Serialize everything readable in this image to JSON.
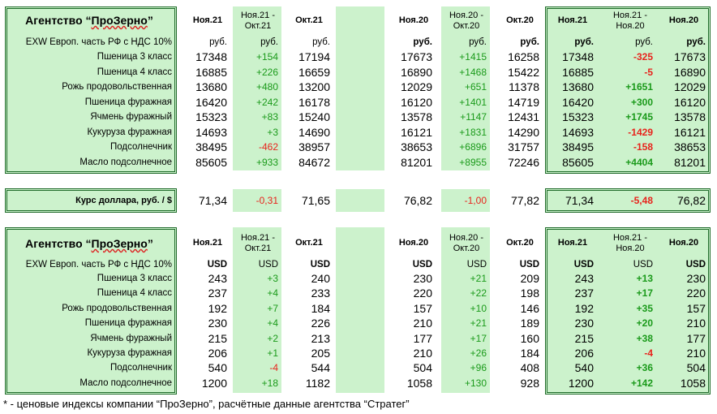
{
  "agency_title_1": "Агентство “",
  "agency_title_2": "ПроЗерно",
  "agency_title_3": "”",
  "col_headers": {
    "c1": "Ноя.21",
    "c2": "Ноя.21 -\nОкт.21",
    "c3": "Окт.21",
    "c4": "Ноя.20",
    "c5": "Ноя.20 -\nОкт.20",
    "c6": "Окт.20",
    "c7": "Ноя.21",
    "c8": "Ноя.21 -\nНоя.20",
    "c9": "Ноя.20"
  },
  "section1": {
    "basis": "EXW Европ. часть РФ с НДС 10%",
    "unit": "руб.",
    "rows": [
      {
        "label": "Пшеница 3 класс",
        "v": [
          "17348",
          "+154",
          "17194",
          "17673",
          "+1415",
          "16258",
          "17348",
          "-325",
          "17673"
        ]
      },
      {
        "label": "Пшеница 4 класс",
        "v": [
          "16885",
          "+226",
          "16659",
          "16890",
          "+1468",
          "15422",
          "16885",
          "-5",
          "16890"
        ]
      },
      {
        "label": "Рожь продовольственная",
        "v": [
          "13680",
          "+480",
          "13200",
          "12029",
          "+651",
          "11378",
          "13680",
          "+1651",
          "12029"
        ]
      },
      {
        "label": "Пшеница фуражная",
        "v": [
          "16420",
          "+242",
          "16178",
          "16120",
          "+1401",
          "14719",
          "16420",
          "+300",
          "16120"
        ]
      },
      {
        "label": "Ячмень фуражный",
        "v": [
          "15323",
          "+83",
          "15240",
          "13578",
          "+1147",
          "12431",
          "15323",
          "+1745",
          "13578"
        ]
      },
      {
        "label": "Кукуруза фуражная",
        "v": [
          "14693",
          "+3",
          "14690",
          "16121",
          "+1831",
          "14290",
          "14693",
          "-1429",
          "16121"
        ]
      },
      {
        "label": "Подсолнечник",
        "v": [
          "38495",
          "-462",
          "38957",
          "38653",
          "+6896",
          "31757",
          "38495",
          "-158",
          "38653"
        ]
      },
      {
        "label": "Масло подсолнечное",
        "v": [
          "85605",
          "+933",
          "84672",
          "81201",
          "+8955",
          "72246",
          "85605",
          "+4404",
          "81201"
        ]
      }
    ]
  },
  "dollar": {
    "label": "Курс доллара, руб. / $",
    "v": [
      "71,34",
      "-0,31",
      "71,65",
      "76,82",
      "-1,00",
      "77,82",
      "71,34",
      "-5,48",
      "76,82"
    ]
  },
  "section2": {
    "basis": "EXW Европ. часть РФ с НДС 10%",
    "unit": "USD",
    "rows": [
      {
        "label": "Пшеница 3 класс",
        "v": [
          "243",
          "+3",
          "240",
          "230",
          "+21",
          "209",
          "243",
          "+13",
          "230"
        ]
      },
      {
        "label": "Пшеница 4 класс",
        "v": [
          "237",
          "+4",
          "233",
          "220",
          "+22",
          "198",
          "237",
          "+17",
          "220"
        ]
      },
      {
        "label": "Рожь продовольственная",
        "v": [
          "192",
          "+7",
          "184",
          "157",
          "+10",
          "146",
          "192",
          "+35",
          "157"
        ]
      },
      {
        "label": "Пшеница фуражная",
        "v": [
          "230",
          "+4",
          "226",
          "210",
          "+21",
          "189",
          "230",
          "+20",
          "210"
        ]
      },
      {
        "label": "Ячмень фуражный",
        "v": [
          "215",
          "+2",
          "213",
          "177",
          "+17",
          "160",
          "215",
          "+38",
          "177"
        ]
      },
      {
        "label": "Кукуруза фуражная",
        "v": [
          "206",
          "+1",
          "205",
          "210",
          "+26",
          "184",
          "206",
          "-4",
          "210"
        ]
      },
      {
        "label": "Подсолнечник",
        "v": [
          "540",
          "-4",
          "544",
          "504",
          "+96",
          "408",
          "540",
          "+36",
          "504"
        ]
      },
      {
        "label": "Масло подсолнечное",
        "v": [
          "1200",
          "+18",
          "1182",
          "1058",
          "+130",
          "928",
          "1200",
          "+142",
          "1058"
        ]
      }
    ]
  },
  "footnote": "* - ценовые индексы компании “ПроЗерно”, расчётные данные агентства “Стратег”",
  "colors": {
    "panel": "#ccf2cc",
    "border": "#1f6b2a",
    "positive": "#1a9a1a",
    "negative": "#e8231c"
  }
}
